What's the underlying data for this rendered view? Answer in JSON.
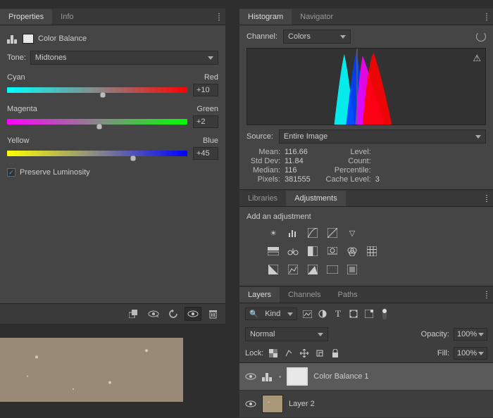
{
  "left": {
    "tabs": {
      "properties": "Properties",
      "info": "Info"
    },
    "cb_title": "Color Balance",
    "tone_label": "Tone:",
    "tone_value": "Midtones",
    "sliders": {
      "cr": {
        "left": "Cyan",
        "right": "Red",
        "value": "+10",
        "pos": 53
      },
      "mg": {
        "left": "Magenta",
        "right": "Green",
        "value": "+2",
        "pos": 51
      },
      "yb": {
        "left": "Yellow",
        "right": "Blue",
        "value": "+45",
        "pos": 70
      }
    },
    "preserve": "Preserve Luminosity"
  },
  "hist": {
    "tabs": {
      "histogram": "Histogram",
      "navigator": "Navigator"
    },
    "channel_label": "Channel:",
    "channel_value": "Colors",
    "source_label": "Source:",
    "source_value": "Entire Image",
    "stats": {
      "mean_l": "Mean:",
      "mean_v": "116.66",
      "std_l": "Std Dev:",
      "std_v": "11.84",
      "med_l": "Median:",
      "med_v": "116",
      "pix_l": "Pixels:",
      "pix_v": "381555",
      "lvl_l": "Level:",
      "lvl_v": "",
      "cnt_l": "Count:",
      "cnt_v": "",
      "pct_l": "Percentile:",
      "pct_v": "",
      "cache_l": "Cache Level:",
      "cache_v": "3"
    }
  },
  "adj": {
    "tabs": {
      "libraries": "Libraries",
      "adjustments": "Adjustments"
    },
    "hint": "Add an adjustment"
  },
  "layers": {
    "tabs": {
      "layers": "Layers",
      "channels": "Channels",
      "paths": "Paths"
    },
    "kind": "Kind",
    "blend": "Normal",
    "opacity_l": "Opacity:",
    "opacity_v": "100%",
    "lock_l": "Lock:",
    "fill_l": "Fill:",
    "fill_v": "100%",
    "items": [
      {
        "name": "Color Balance 1"
      },
      {
        "name": "Layer 2"
      }
    ]
  }
}
